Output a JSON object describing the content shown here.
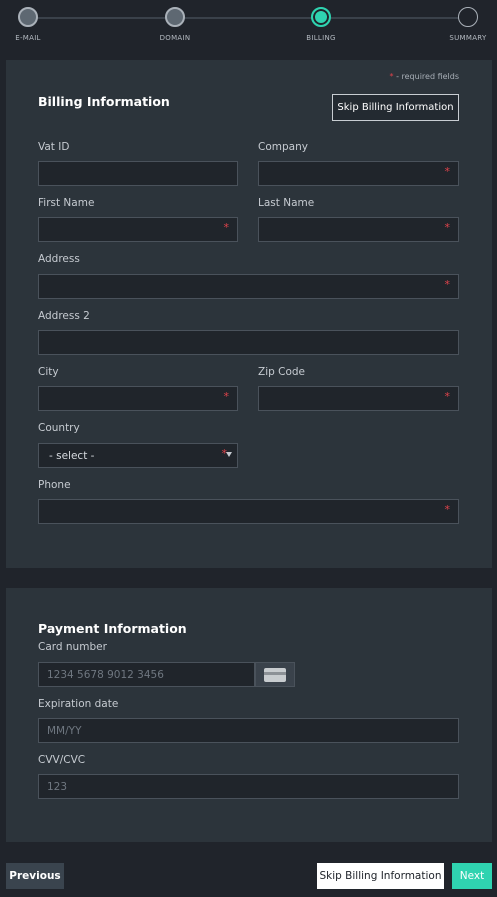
{
  "stepper": {
    "steps": [
      {
        "label": "E-MAIL",
        "state": "done"
      },
      {
        "label": "DOMAIN",
        "state": "done"
      },
      {
        "label": "BILLING",
        "state": "active"
      },
      {
        "label": "SUMMARY",
        "state": "future"
      }
    ]
  },
  "billing": {
    "required_note": "- required fields",
    "required_star": "*",
    "title": "Billing Information",
    "skip_label": "Skip Billing Information",
    "fields": {
      "vat": {
        "label": "Vat ID"
      },
      "company": {
        "label": "Company"
      },
      "first_name": {
        "label": "First Name"
      },
      "last_name": {
        "label": "Last Name"
      },
      "address": {
        "label": "Address"
      },
      "address2": {
        "label": "Address 2"
      },
      "city": {
        "label": "City"
      },
      "zip": {
        "label": "Zip Code"
      },
      "country": {
        "label": "Country",
        "selected": "- select -"
      },
      "phone": {
        "label": "Phone"
      }
    }
  },
  "payment": {
    "title": "Payment Information",
    "card_number": {
      "label": "Card number",
      "placeholder": "1234 5678 9012 3456"
    },
    "expiration": {
      "label": "Expiration date",
      "placeholder": "MM/YY"
    },
    "cvv": {
      "label": "CVV/CVC",
      "placeholder": "123"
    }
  },
  "footer": {
    "previous_label": "Previous",
    "skip_label": "Skip Billing Information",
    "next_label": "Next"
  },
  "colors": {
    "accent": "#2fd3b0",
    "required": "#e0434b",
    "panel": "#2c343b",
    "background": "#20242b"
  },
  "icons": {
    "card": "credit-card-icon",
    "dropdown": "caret-down-icon"
  }
}
